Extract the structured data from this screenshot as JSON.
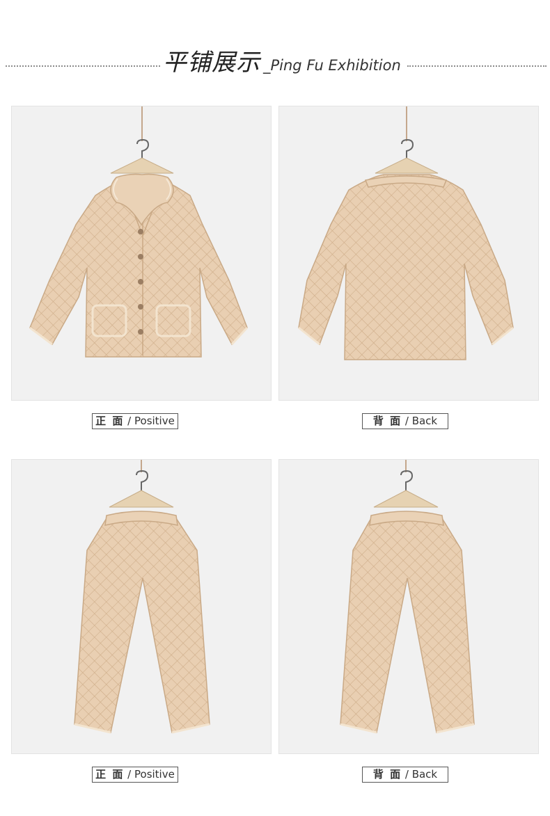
{
  "header": {
    "title_cn": "平铺展示",
    "title_en": "_Ping Fu Exhibition"
  },
  "colors": {
    "fabric": "#e8ceb1",
    "fabric_shadow": "#d4b592",
    "trim": "#f3e4cf",
    "panel_bg": "#f1f1f1",
    "hanger_wood": "#e6d2b2"
  },
  "gallery": [
    {
      "item": "jacket",
      "view": "front",
      "icon": "jacket-front-image",
      "label_cn": "正 面",
      "label_sep": " / ",
      "label_en": "Positive"
    },
    {
      "item": "jacket",
      "view": "back",
      "icon": "jacket-back-image",
      "label_cn": "背 面",
      "label_sep": " / ",
      "label_en": "Back"
    },
    {
      "item": "pants",
      "view": "front",
      "icon": "pants-front-image",
      "label_cn": "正 面",
      "label_sep": " / ",
      "label_en": "Positive"
    },
    {
      "item": "pants",
      "view": "back",
      "icon": "pants-back-image",
      "label_cn": "背 面",
      "label_sep": " / ",
      "label_en": "Back"
    }
  ]
}
